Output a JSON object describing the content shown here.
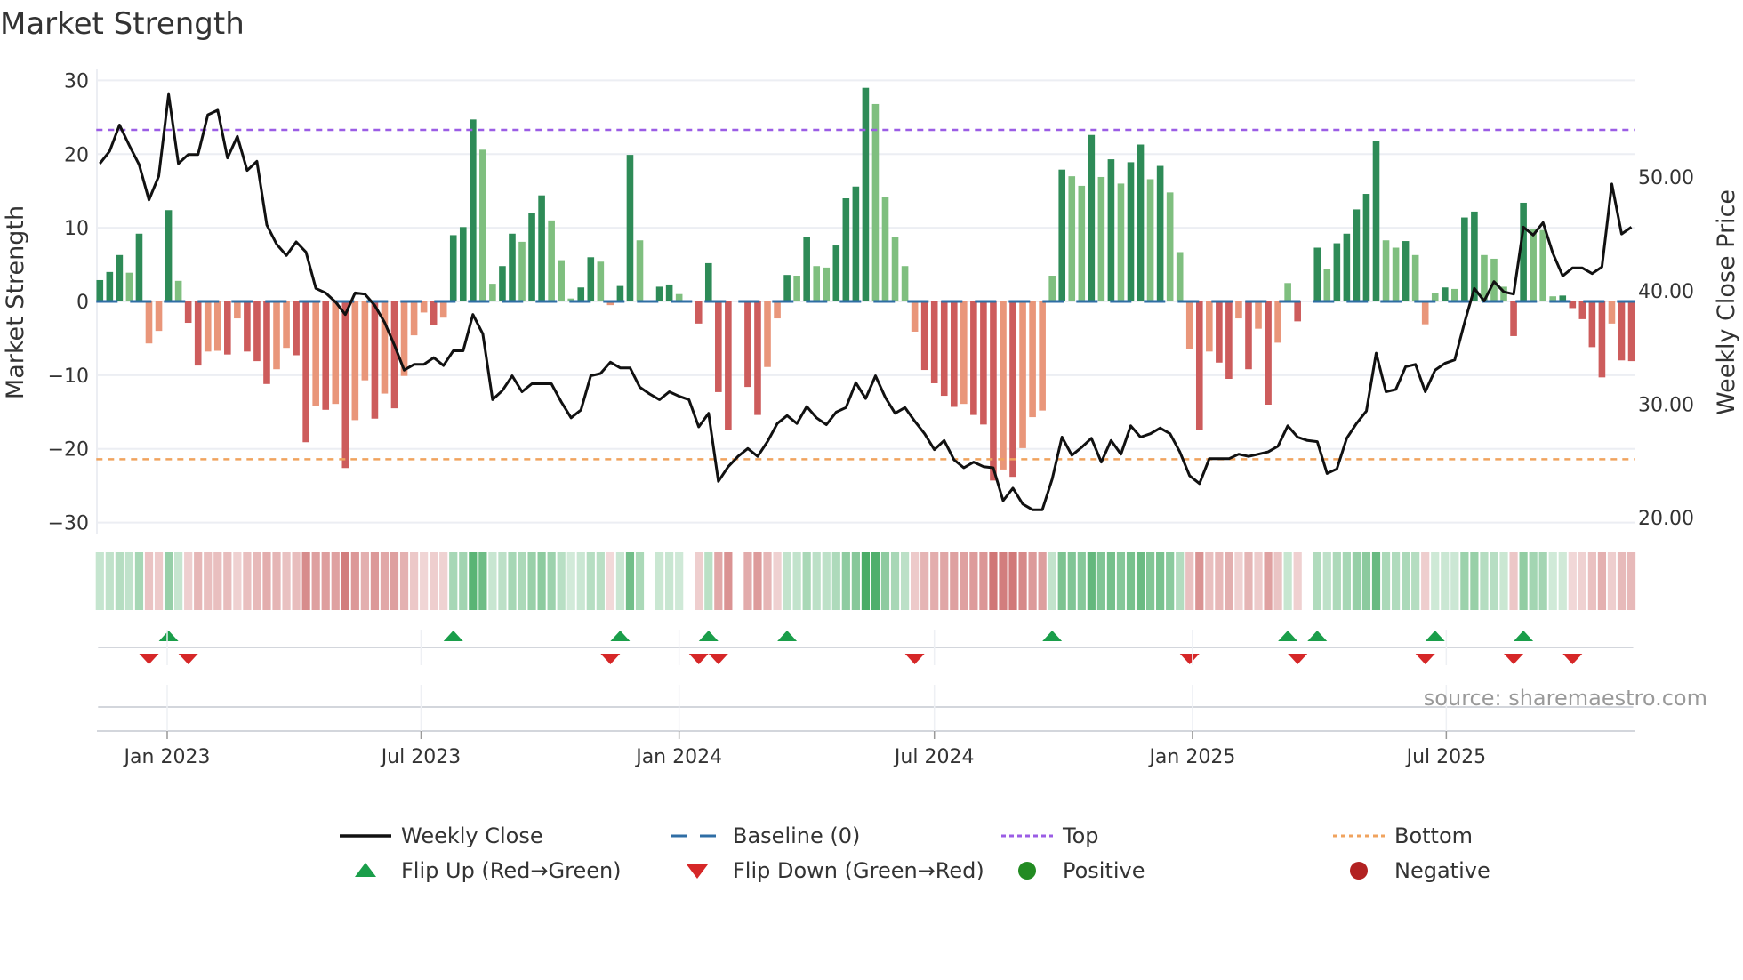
{
  "chart_data": {
    "type": "bar+line",
    "title": "Market Strength",
    "ylabel": "Market Strength",
    "y2label": "Weekly Close Price",
    "source": "source: sharemaestro.com",
    "start_week": "2022-11-14",
    "ylim": [
      -31.5,
      31.5
    ],
    "y2lim": [
      18.6,
      59.5
    ],
    "y_ticks": [
      {
        "v": 30,
        "label": "30"
      },
      {
        "v": 20,
        "label": "20"
      },
      {
        "v": 10,
        "label": "10"
      },
      {
        "v": 0,
        "label": "0"
      },
      {
        "v": -10,
        "label": "−10"
      },
      {
        "v": -20,
        "label": "−20"
      },
      {
        "v": -30,
        "label": "−30"
      }
    ],
    "y2_ticks": [
      {
        "v": 50,
        "label": "50.00"
      },
      {
        "v": 40,
        "label": "40.00"
      },
      {
        "v": 30,
        "label": "30.00"
      },
      {
        "v": 20,
        "label": "20.00"
      }
    ],
    "x_ticks": [
      {
        "date": "2023-01-01",
        "label": "Jan 2023"
      },
      {
        "date": "2023-07-01",
        "label": "Jul 2023"
      },
      {
        "date": "2024-01-01",
        "label": "Jan 2024"
      },
      {
        "date": "2024-07-01",
        "label": "Jul 2024"
      },
      {
        "date": "2025-01-01",
        "label": "Jan 2025"
      },
      {
        "date": "2025-07-01",
        "label": "Jul 2025"
      }
    ],
    "top_level": 23.3,
    "bottom_level": -21.4,
    "strength": [
      2.9,
      4.0,
      6.3,
      3.9,
      9.2,
      -5.7,
      -4.0,
      12.4,
      2.8,
      -2.9,
      -8.7,
      -6.8,
      -6.7,
      -7.2,
      -2.3,
      -6.8,
      -8.1,
      -11.2,
      -9.2,
      -6.3,
      -7.3,
      -19.1,
      -14.2,
      -14.7,
      -13.9,
      -22.6,
      -16.1,
      -10.7,
      -15.9,
      -12.5,
      -14.5,
      -10.1,
      -4.6,
      -1.5,
      -3.2,
      -2.2,
      9.0,
      10.1,
      24.7,
      20.6,
      2.4,
      4.8,
      9.2,
      8.1,
      12.0,
      14.4,
      11.0,
      5.6,
      0.4,
      1.9,
      6.0,
      5.4,
      -0.5,
      2.1,
      19.9,
      8.3,
      0,
      2.0,
      2.3,
      1.0,
      0,
      -3.0,
      5.2,
      -12.3,
      -17.5,
      0,
      -11.6,
      -15.4,
      -8.9,
      -2.3,
      3.6,
      3.5,
      8.7,
      4.8,
      4.6,
      7.6,
      14.0,
      15.6,
      29.0,
      26.8,
      14.2,
      8.8,
      4.8,
      -4.1,
      -9.3,
      -11.1,
      -12.8,
      -14.3,
      -13.9,
      -15.4,
      -16.7,
      -24.3,
      -22.8,
      -23.8,
      -19.9,
      -15.7,
      -14.8,
      3.5,
      17.9,
      17.0,
      15.7,
      22.6,
      16.9,
      19.3,
      16.0,
      18.9,
      21.3,
      16.6,
      18.4,
      14.8,
      6.7,
      -6.5,
      -17.5,
      -6.8,
      -8.3,
      -10.5,
      -2.3,
      -9.2,
      -3.7,
      -14.0,
      -5.6,
      2.5,
      -2.7,
      0,
      7.3,
      4.4,
      7.9,
      9.2,
      12.5,
      14.6,
      21.8,
      8.3,
      7.3,
      8.2,
      6.3,
      -3.1,
      1.2,
      1.9,
      1.7,
      11.4,
      12.2,
      6.3,
      5.8,
      2.0,
      -4.7,
      13.4,
      9.8,
      9.7,
      0.7,
      0.8,
      -0.9,
      -2.4,
      -6.2,
      -10.3,
      -3.0,
      -8.0,
      -8.1
    ],
    "weekly_close": [
      51.2,
      52.3,
      54.6,
      52.8,
      51.1,
      48.0,
      50.1,
      57.3,
      51.2,
      52.0,
      52.0,
      55.5,
      55.9,
      51.7,
      53.6,
      50.6,
      51.4,
      45.8,
      44.1,
      43.1,
      44.3,
      43.4,
      40.2,
      39.8,
      39.0,
      37.9,
      39.8,
      39.7,
      38.7,
      37.2,
      35.2,
      33.0,
      33.5,
      33.5,
      34.1,
      33.4,
      34.7,
      34.7,
      37.9,
      36.2,
      30.4,
      31.2,
      32.5,
      31.1,
      31.8,
      31.8,
      31.8,
      30.2,
      28.8,
      29.5,
      32.5,
      32.7,
      33.7,
      33.2,
      33.2,
      31.5,
      30.9,
      30.4,
      31.1,
      30.7,
      30.4,
      28.0,
      29.2,
      23.2,
      24.5,
      25.4,
      26.1,
      25.4,
      26.7,
      28.3,
      29.0,
      28.3,
      29.8,
      28.8,
      28.2,
      29.3,
      29.7,
      31.9,
      30.5,
      32.5,
      30.6,
      29.2,
      29.7,
      28.5,
      27.4,
      26.0,
      26.8,
      25.1,
      24.4,
      24.9,
      24.5,
      24.4,
      21.5,
      22.6,
      21.2,
      20.7,
      20.7,
      23.4,
      27.1,
      25.5,
      26.2,
      27.0,
      24.9,
      26.8,
      25.6,
      28.1,
      27.1,
      27.4,
      27.9,
      27.4,
      25.8,
      23.7,
      23.0,
      25.2,
      25.2,
      25.2,
      25.6,
      25.4,
      25.6,
      25.8,
      26.3,
      28.1,
      27.1,
      26.8,
      26.7,
      23.9,
      24.3,
      27.0,
      28.3,
      29.4,
      34.5,
      31.1,
      31.3,
      33.3,
      33.5,
      31.1,
      33.0,
      33.6,
      33.9,
      37.2,
      40.2,
      39.1,
      40.8,
      39.9,
      39.7,
      45.6,
      44.9,
      46.0,
      43.3,
      41.3,
      42.0,
      42.0,
      41.5,
      42.1,
      49.4,
      45.0,
      45.6
    ],
    "legend": {
      "placement": "bottom",
      "items": [
        {
          "key": "close",
          "label": "Weekly Close"
        },
        {
          "key": "baseline",
          "label": "Baseline (0)"
        },
        {
          "key": "top",
          "label": "Top"
        },
        {
          "key": "bottom",
          "label": "Bottom"
        },
        {
          "key": "flipup",
          "label": "Flip Up (Red→Green)"
        },
        {
          "key": "flipdown",
          "label": "Flip Down (Green→Red)"
        },
        {
          "key": "positive",
          "label": "Positive"
        },
        {
          "key": "negative",
          "label": "Negative"
        }
      ]
    },
    "colors": {
      "pos_strong": "#2e8b57",
      "pos_weak": "#7fbf7f",
      "neg_strong": "#cd5c5c",
      "neg_weak": "#e9967a",
      "close": "#111111",
      "baseline": "#2f6ea5",
      "top": "#9b5de5",
      "bottom": "#f0a35e",
      "flip_up": "#1a9e4a",
      "flip_down": "#d62728",
      "positive": "#228b22",
      "negative": "#b22222",
      "heat_pos": "#3aa55a",
      "heat_neg": "#c65a5a",
      "grid": "#eceef3"
    }
  }
}
